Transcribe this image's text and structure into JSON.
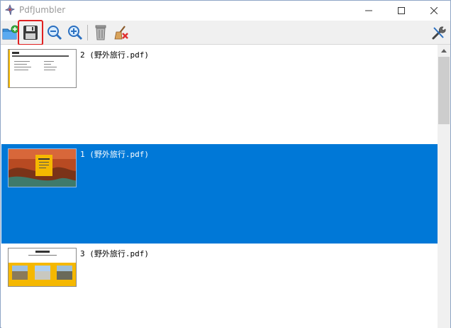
{
  "window": {
    "title": "PdfJumbler"
  },
  "toolbar": {
    "icons": [
      "open-add-icon",
      "save-icon",
      "zoom-out-icon",
      "zoom-in-icon",
      "trash-icon",
      "clear-broom-icon",
      "tools-icon"
    ]
  },
  "pages": [
    {
      "label": "2 (野外旅行.pdf)",
      "selected": false
    },
    {
      "label": "1 (野外旅行.pdf)",
      "selected": true
    },
    {
      "label": "3 (野外旅行.pdf)",
      "selected": false
    }
  ],
  "colors": {
    "selection": "#0078d7",
    "highlight_box": "#e02020",
    "thumb_accent": "#f5b800"
  }
}
